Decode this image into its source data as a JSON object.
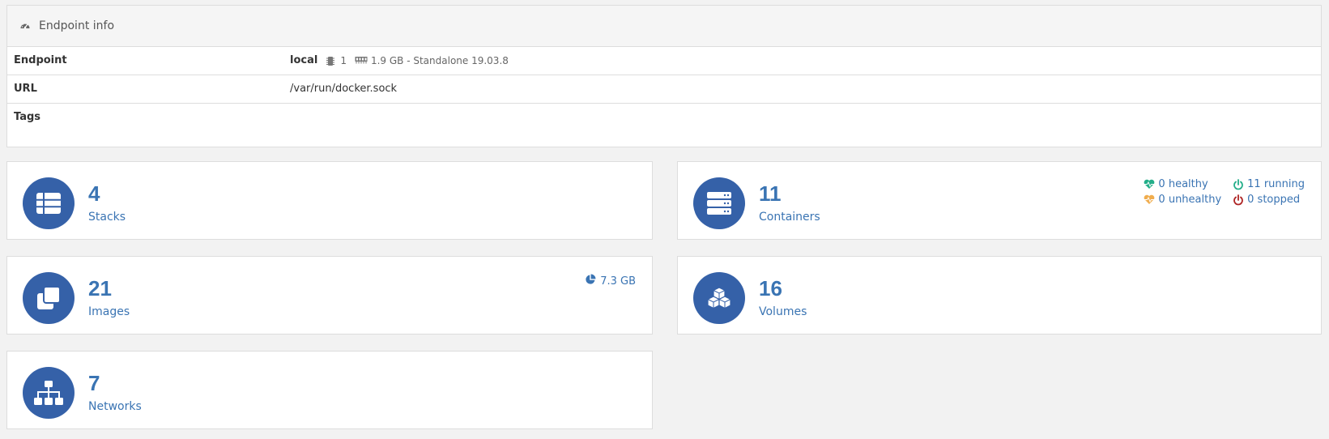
{
  "endpoint_info": {
    "title": "Endpoint info",
    "rows": {
      "endpoint": {
        "label": "Endpoint",
        "name": "local",
        "cpu": "1",
        "memory": "1.9 GB - Standalone 19.03.8"
      },
      "url": {
        "label": "URL",
        "value": "/var/run/docker.sock"
      },
      "tags": {
        "label": "Tags",
        "value": ""
      }
    }
  },
  "widgets": {
    "stacks": {
      "count": "4",
      "label": "Stacks",
      "icon": "list-icon"
    },
    "containers": {
      "count": "11",
      "label": "Containers",
      "icon": "server-icon",
      "healthy": "0 healthy",
      "running": "11 running",
      "unhealthy": "0 unhealthy",
      "stopped": "0 stopped"
    },
    "images": {
      "count": "21",
      "label": "Images",
      "icon": "clone-icon",
      "size": "7.3 GB"
    },
    "volumes": {
      "count": "16",
      "label": "Volumes",
      "icon": "cubes-icon"
    },
    "networks": {
      "count": "7",
      "label": "Networks",
      "icon": "sitemap-icon"
    }
  },
  "colors": {
    "accent": "#3561a8",
    "text_blue": "#3a74b3",
    "healthy": "#23ae89",
    "unhealthy": "#f0ad4e",
    "stopped": "#ae2323"
  }
}
